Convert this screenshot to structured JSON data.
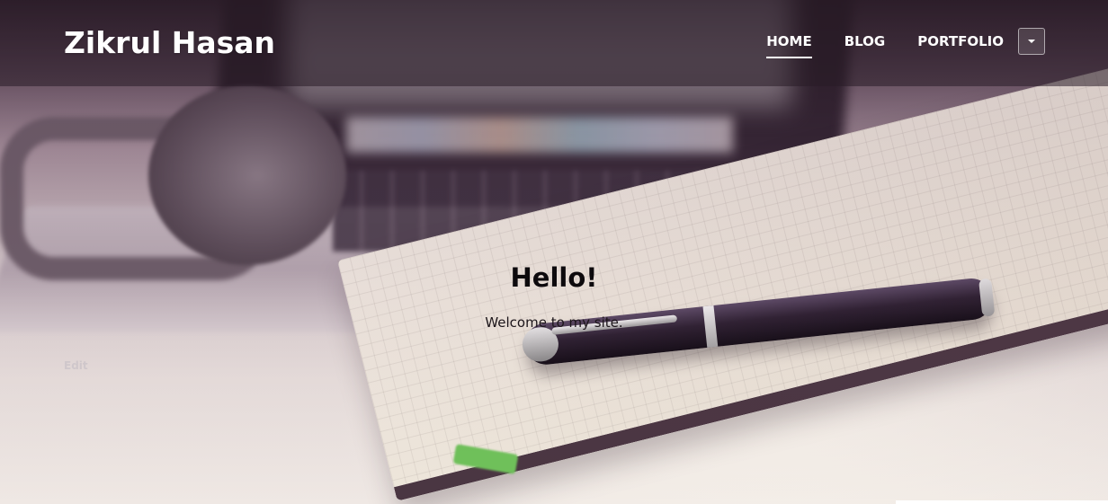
{
  "site": {
    "title": "Zikrul Hasan"
  },
  "nav": {
    "items": [
      {
        "label": "HOME",
        "active": true
      },
      {
        "label": "BLOG",
        "active": false
      },
      {
        "label": "PORTFOLIO",
        "active": false
      }
    ],
    "dropdown_icon": "caret-down-icon"
  },
  "hero": {
    "heading": "Hello!",
    "text": "Welcome to my site.",
    "edit_label": "Edit",
    "background_image": "desk with laptop, headphones, notebook and pen"
  },
  "colors": {
    "nav_text": "#ffffff",
    "heading": "#0d0a0d",
    "edit_link": "#cfc7cb"
  }
}
